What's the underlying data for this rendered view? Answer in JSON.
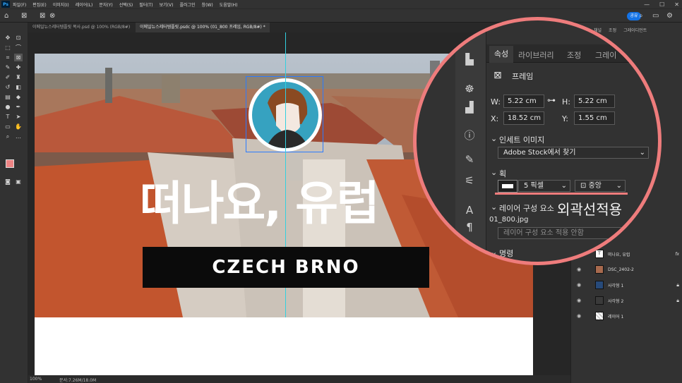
{
  "menu": {
    "app_badge": "Ps",
    "items": [
      "파일(F)",
      "편집(E)",
      "이미지(I)",
      "레이어(L)",
      "문자(Y)",
      "선택(S)",
      "필터(T)",
      "보기(V)",
      "플러그인",
      "창(W)",
      "도움말(H)"
    ],
    "window_controls": [
      "—",
      "☐",
      "✕"
    ]
  },
  "options": {
    "share_label": "공유"
  },
  "tabs": [
    {
      "label": "이메일뉴스레터템플릿 복사.psd @ 100% (RGB/8#)"
    },
    {
      "label": "이메일뉴스레터템플릿.psdc @ 100% (01_800 프레임, RGB/8#) *"
    }
  ],
  "canvas": {
    "headline": "떠나요, 유럽",
    "banner_text": "CZECH BRNO"
  },
  "status": {
    "zoom": "100%",
    "doc_info": "문서:7.26M/18.0M"
  },
  "right_panel": {
    "top_tabs": [
      "채널",
      "조정",
      "그레이디언트"
    ],
    "layers": [
      {
        "name": "떠나요, 유럽",
        "visible": true,
        "lock": false,
        "fx": true
      },
      {
        "name": "DSC_2402-2",
        "visible": true,
        "lock": false,
        "fx": false
      },
      {
        "name": "사각형 1",
        "visible": true,
        "lock": true,
        "fx": false
      },
      {
        "name": "사각형 2",
        "visible": true,
        "lock": true,
        "fx": false
      },
      {
        "name": "레이어 1",
        "visible": true,
        "lock": false,
        "fx": false
      }
    ],
    "fx_label": "fx"
  },
  "zoom_panel": {
    "tabs": [
      "속성",
      "라이브러리",
      "조정",
      "그레이"
    ],
    "section_title": "프레임",
    "w_label": "W:",
    "w_value": "5.22 cm",
    "h_label": "H:",
    "h_value": "5.22 cm",
    "x_label": "X:",
    "x_value": "18.52 cm",
    "y_label": "Y:",
    "y_value": "1.55 cm",
    "inset_title": "인세트 이미지",
    "inset_select": "Adobe Stock에서 찾기",
    "stroke_title": "획",
    "stroke_size": "5 픽셀",
    "stroke_align": "중앙",
    "annotation": "외곽선적용",
    "layer_comp_title": "레이어 구성 요소",
    "layer_comp_file": "01_800.jpg",
    "layer_comp_apply": "레이어 구성 요소 적용 안함",
    "commands_title": "명령",
    "accent_color": "#ee7c7c"
  }
}
